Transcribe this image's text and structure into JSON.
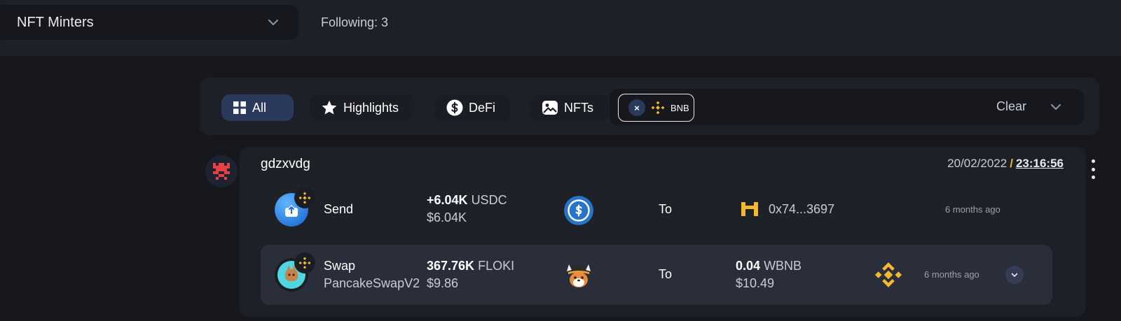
{
  "header": {
    "list_selector": "NFT Minters",
    "following": "Following: 3"
  },
  "filters": {
    "chips": [
      {
        "label": "All",
        "icon": "grid-icon",
        "active": true
      },
      {
        "label": "Highlights",
        "icon": "star-icon",
        "active": false
      },
      {
        "label": "DeFi",
        "icon": "dollar-icon",
        "active": false
      },
      {
        "label": "NFTs",
        "icon": "image-icon",
        "active": false
      }
    ],
    "chain_chip": {
      "remove": "×",
      "label": "BNB"
    },
    "clear": "Clear"
  },
  "feed": {
    "wallet": "gdzxvdg",
    "date": "20/02/2022",
    "separator": "/",
    "time": "23:16:56",
    "transactions": [
      {
        "type": "Send",
        "amount": "+6.04K",
        "token": "USDC",
        "usd": "$6.04K",
        "to_label": "To",
        "recipient": "0x74...3697",
        "ago": "6 months ago"
      },
      {
        "type": "Swap",
        "protocol": "PancakeSwapV2",
        "amount": "367.76K",
        "token": "FLOKI",
        "usd": "$9.86",
        "to_label": "To",
        "out_amount": "0.04",
        "out_token": "WBNB",
        "out_usd": "$10.49",
        "ago": "6 months ago"
      }
    ]
  },
  "colors": {
    "background": "#16181e",
    "panel": "#1e2028",
    "active_chip": "#2b3a5c",
    "bnb_yellow": "#f3ba2f",
    "usdc_blue": "#2775ca",
    "avatar_red": "#e84142"
  }
}
